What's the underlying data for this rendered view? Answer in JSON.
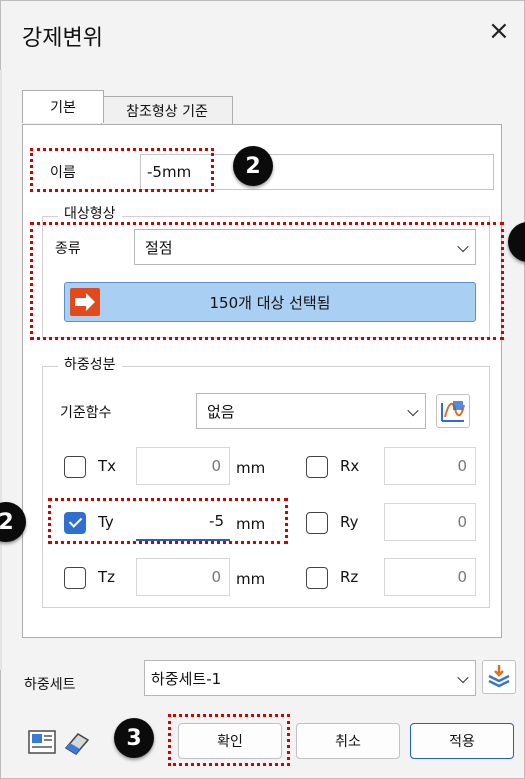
{
  "window": {
    "title": "강제변위",
    "close_symbol": "×"
  },
  "tabs": [
    {
      "label": "기본",
      "selected": true
    },
    {
      "label": "참조형상 기준",
      "selected": false
    }
  ],
  "name_field": {
    "label": "이름",
    "value": "-5mm"
  },
  "target": {
    "group_label": "대상형상",
    "type_label": "종류",
    "type_value": "절점",
    "select_button_label": "150개 대상 선택됨"
  },
  "load_components": {
    "group_label": "하중성분",
    "ref_function_label": "기준함수",
    "ref_function_value": "없음",
    "rows": [
      {
        "t_label": "Tx",
        "t_checked": false,
        "t_value": "0",
        "unit": "mm",
        "r_label": "Rx",
        "r_checked": false,
        "r_value": "0"
      },
      {
        "t_label": "Ty",
        "t_checked": true,
        "t_value": "-5",
        "unit": "mm",
        "r_label": "Ry",
        "r_checked": false,
        "r_value": "0"
      },
      {
        "t_label": "Tz",
        "t_checked": false,
        "t_value": "0",
        "unit": "mm",
        "r_label": "Rz",
        "r_checked": false,
        "r_value": "0"
      }
    ]
  },
  "load_set": {
    "label": "하중세트",
    "value": "하중세트-1"
  },
  "buttons": {
    "ok": "확인",
    "cancel": "취소",
    "apply": "적용"
  },
  "badges": {
    "name": "2",
    "ty": "2",
    "ok": "3"
  },
  "colors": {
    "annotation_dotted": "#d40000",
    "select_button": "#a9d0f2",
    "checkbox_on": "#2f6fd0",
    "primary_border": "#1d62c4"
  }
}
